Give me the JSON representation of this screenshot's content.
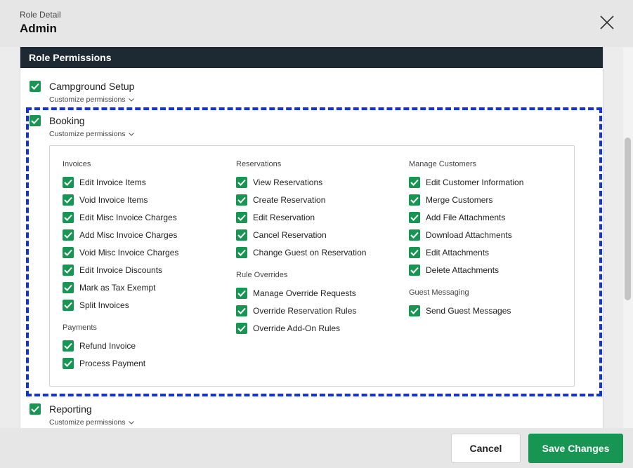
{
  "header": {
    "subtitle": "Role Detail",
    "title": "Admin"
  },
  "panel": {
    "title": "Role Permissions"
  },
  "groups": {
    "campground": {
      "label": "Campground Setup",
      "customize": "Customize permissions"
    },
    "booking": {
      "label": "Booking",
      "customize": "Customize permissions"
    },
    "reporting": {
      "label": "Reporting",
      "customize": "Customize permissions"
    }
  },
  "booking": {
    "invoices": {
      "title": "Invoices",
      "items": [
        "Edit Invoice Items",
        "Void Invoice Items",
        "Edit Misc Invoice Charges",
        "Add Misc Invoice Charges",
        "Void Misc Invoice Charges",
        "Edit Invoice Discounts",
        "Mark as Tax Exempt",
        "Split Invoices"
      ]
    },
    "payments": {
      "title": "Payments",
      "items": [
        "Refund Invoice",
        "Process Payment"
      ]
    },
    "reservations": {
      "title": "Reservations",
      "items": [
        "View Reservations",
        "Create Reservation",
        "Edit Reservation",
        "Cancel Reservation",
        "Change Guest on Reservation"
      ]
    },
    "rule_overrides": {
      "title": "Rule Overrides",
      "items": [
        "Manage Override Requests",
        "Override Reservation Rules",
        "Override Add-On Rules"
      ]
    },
    "manage_customers": {
      "title": "Manage Customers",
      "items": [
        "Edit Customer Information",
        "Merge Customers",
        "Add File Attachments",
        "Download Attachments",
        "Edit Attachments",
        "Delete Attachments"
      ]
    },
    "guest_messaging": {
      "title": "Guest Messaging",
      "items": [
        "Send Guest Messages"
      ]
    }
  },
  "footer": {
    "cancel_label": "Cancel",
    "save_label": "Save Changes"
  },
  "colors": {
    "accent": "#179653",
    "header_bar": "#1e2a33",
    "highlight": "#1133dd"
  },
  "icons": {
    "close": "close-icon",
    "check": "check-icon",
    "chevron": "chevron-down-icon"
  }
}
